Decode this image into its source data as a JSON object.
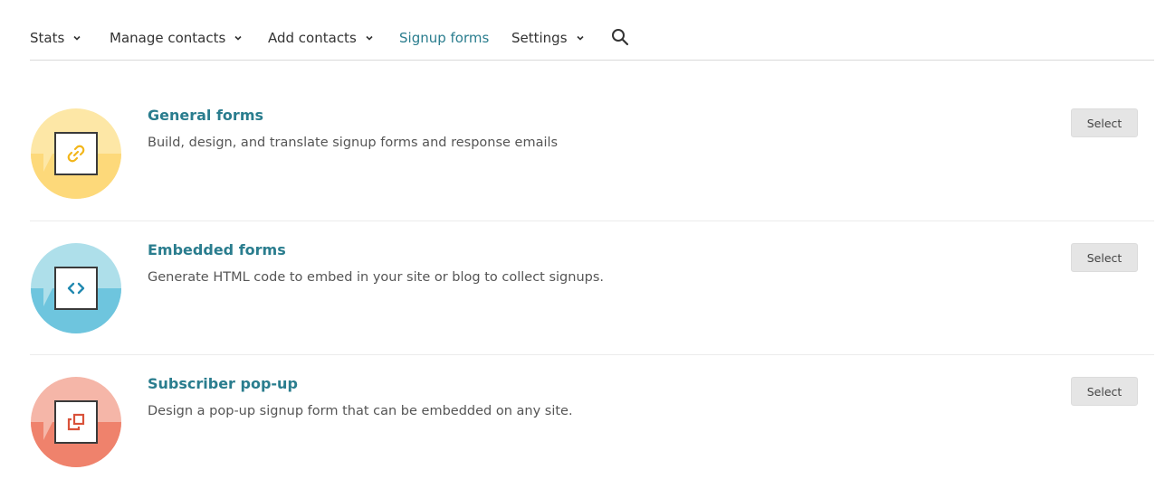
{
  "nav": {
    "items": [
      {
        "label": "Stats",
        "has_dropdown": true,
        "active": false
      },
      {
        "label": "Manage contacts",
        "has_dropdown": true,
        "active": false
      },
      {
        "label": "Add contacts",
        "has_dropdown": true,
        "active": false
      },
      {
        "label": "Signup forms",
        "has_dropdown": false,
        "active": true
      },
      {
        "label": "Settings",
        "has_dropdown": true,
        "active": false
      }
    ],
    "search_icon": "search-icon"
  },
  "forms": [
    {
      "title": "General forms",
      "description": "Build, design, and translate signup forms and response emails",
      "button_label": "Select",
      "icon": "link-icon",
      "colors": {
        "top": "#fde7a6",
        "bottom": "#fdd97a",
        "glyph": "#f2b61b"
      }
    },
    {
      "title": "Embedded forms",
      "description": "Generate HTML code to embed in your site or blog to collect signups.",
      "button_label": "Select",
      "icon": "code-icon",
      "colors": {
        "top": "#aedfea",
        "bottom": "#6ec5de",
        "glyph": "#2189b0"
      }
    },
    {
      "title": "Subscriber pop-up",
      "description": "Design a pop-up signup form that can be embedded on any site.",
      "button_label": "Select",
      "icon": "popup-icon",
      "colors": {
        "top": "#f5b6a8",
        "bottom": "#ef826c",
        "glyph": "#d9523a"
      }
    }
  ],
  "accent_color": "#2a7d8e"
}
